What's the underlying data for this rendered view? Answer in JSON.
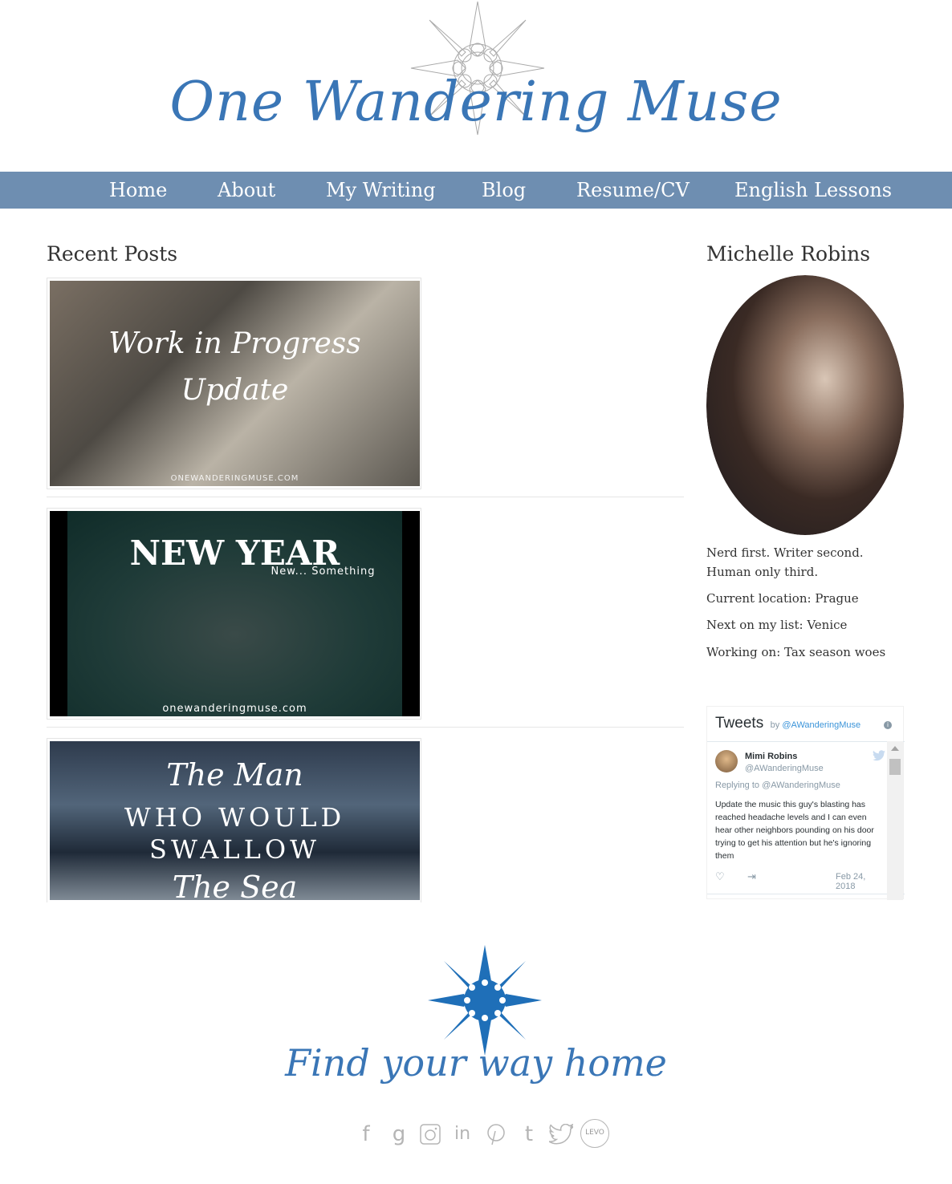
{
  "site": {
    "title": "One Wandering Muse"
  },
  "nav": {
    "items": [
      "Home",
      "About",
      "My Writing",
      "Blog",
      "Resume/CV",
      "English Lessons"
    ]
  },
  "main": {
    "section_title": "Recent Posts",
    "posts": [
      {
        "line1": "Work in Progress",
        "line2": "Update",
        "line3": "ONEWANDERINGMUSE.COM"
      },
      {
        "line1": "NEW YEAR",
        "line2": "New... Something",
        "line3": "onewanderingmuse.com"
      },
      {
        "line1": "The Man",
        "line2": "WHO WOULD",
        "line3": "SWALLOW",
        "line4": "The Sea"
      }
    ]
  },
  "sidebar": {
    "title": "Michelle Robins",
    "bio": [
      "Nerd first. Writer second.",
      "Human only third.",
      "Current location: Prague",
      "Next on my list: Venice",
      "Working on: Tax season woes"
    ],
    "twitter": {
      "title": "Tweets",
      "by": "by",
      "handle": "@AWanderingMuse",
      "tweet": {
        "name": "Mimi Robins",
        "user": "@AWanderingMuse",
        "reply": "Replying to @AWanderingMuse",
        "text": "Update the music this guy's blasting has reached headache levels and I can even hear other neighbors pounding on his door trying to get his attention but he's ignoring them",
        "date": "Feb 24, 2018"
      }
    }
  },
  "footer": {
    "tagline": "Find your way home",
    "social": [
      "facebook-icon",
      "goodreads-icon",
      "instagram-icon",
      "linkedin-icon",
      "pinterest-icon",
      "tumblr-icon",
      "twitter-icon",
      "levo-icon"
    ],
    "levo_label": "LEVO"
  }
}
